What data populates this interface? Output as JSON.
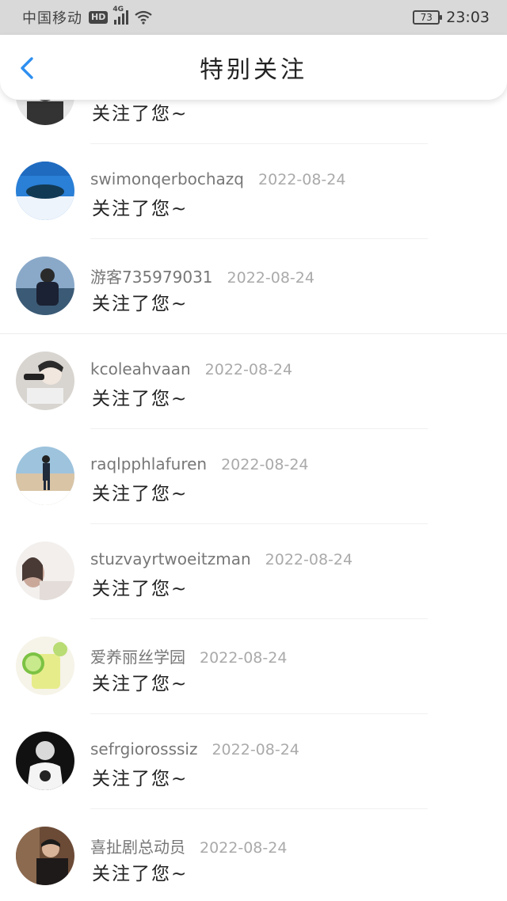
{
  "status_bar": {
    "carrier": "中国移动",
    "hd": "HD",
    "network": "4G",
    "battery": "73",
    "time": "23:03"
  },
  "header": {
    "title": "特别关注",
    "back_icon": "chevron-left-icon"
  },
  "accent_color": "#2f8ff0",
  "items": [
    {
      "username": "",
      "date": "",
      "message": "关注了您~"
    },
    {
      "username": "swimonqerbochazq",
      "date": "2022-08-24",
      "message": "关注了您~"
    },
    {
      "username": "游客735979031",
      "date": "2022-08-24",
      "message": "关注了您~"
    },
    {
      "username": "kcoleahvaan",
      "date": "2022-08-24",
      "message": "关注了您~"
    },
    {
      "username": "raqlpphlafuren",
      "date": "2022-08-24",
      "message": "关注了您~"
    },
    {
      "username": "stuzvayrtwoeitzman",
      "date": "2022-08-24",
      "message": "关注了您~"
    },
    {
      "username": "爱养丽丝学园",
      "date": "2022-08-24",
      "message": "关注了您~"
    },
    {
      "username": "sefrgiorosssiz",
      "date": "2022-08-24",
      "message": "关注了您~"
    },
    {
      "username": "喜扯剧总动员",
      "date": "2022-08-24",
      "message": "关注了您~"
    }
  ]
}
